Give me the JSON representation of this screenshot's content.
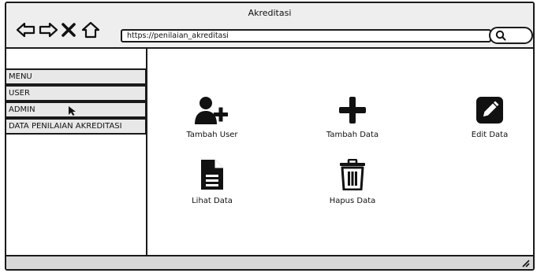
{
  "window": {
    "title": "Akreditasi"
  },
  "addressbar": {
    "url": "https://penilaian_akreditasi"
  },
  "sidebar": {
    "items": [
      {
        "label": "MENU"
      },
      {
        "label": "USER"
      },
      {
        "label": "ADMIN"
      },
      {
        "label": "DATA PENILAIAN AKREDITASI"
      }
    ]
  },
  "actions": [
    {
      "label": "Tambah User",
      "icon": "user-plus-icon"
    },
    {
      "label": "Tambah Data",
      "icon": "plus-icon"
    },
    {
      "label": "Edit Data",
      "icon": "pencil-square-icon"
    },
    {
      "label": "Lihat Data",
      "icon": "document-icon"
    },
    {
      "label": "Hapus Data",
      "icon": "trash-icon"
    }
  ]
}
